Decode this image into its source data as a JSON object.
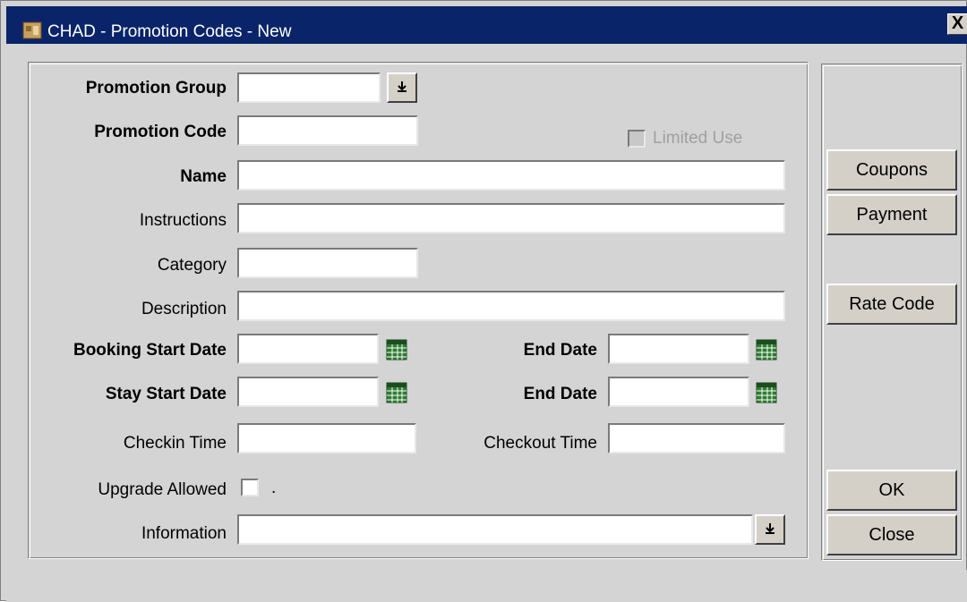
{
  "window": {
    "title": "CHAD - Promotion Codes - New",
    "close_label": "X"
  },
  "form": {
    "promotion_group": {
      "label": "Promotion Group",
      "value": "",
      "dropdown_icon": "arrow-down-icon"
    },
    "promotion_code": {
      "label": "Promotion Code",
      "value": ""
    },
    "limited_use": {
      "label": "Limited Use",
      "checked": false,
      "enabled": false
    },
    "name": {
      "label": "Name",
      "value": ""
    },
    "instructions": {
      "label": "Instructions",
      "value": ""
    },
    "category": {
      "label": "Category",
      "value": ""
    },
    "description": {
      "label": "Description",
      "value": ""
    },
    "booking_start_date": {
      "label": "Booking Start Date",
      "value": ""
    },
    "booking_end_date": {
      "label": "End Date",
      "value": ""
    },
    "stay_start_date": {
      "label": "Stay Start Date",
      "value": ""
    },
    "stay_end_date": {
      "label": "End Date",
      "value": ""
    },
    "checkin_time": {
      "label": "Checkin Time",
      "value": ""
    },
    "checkout_time": {
      "label": "Checkout Time",
      "value": ""
    },
    "upgrade_allowed": {
      "label": "Upgrade Allowed",
      "checked": false,
      "dot": "."
    },
    "information": {
      "label": "Information",
      "value": ""
    }
  },
  "buttons": {
    "coupons": "Coupons",
    "payment": "Payment",
    "rate_code": "Rate Code",
    "ok": "OK",
    "close": "Close"
  },
  "colors": {
    "titlebar": "#0a246a",
    "background": "#d4d4d4",
    "calendar_icon": "#2e7d32"
  }
}
